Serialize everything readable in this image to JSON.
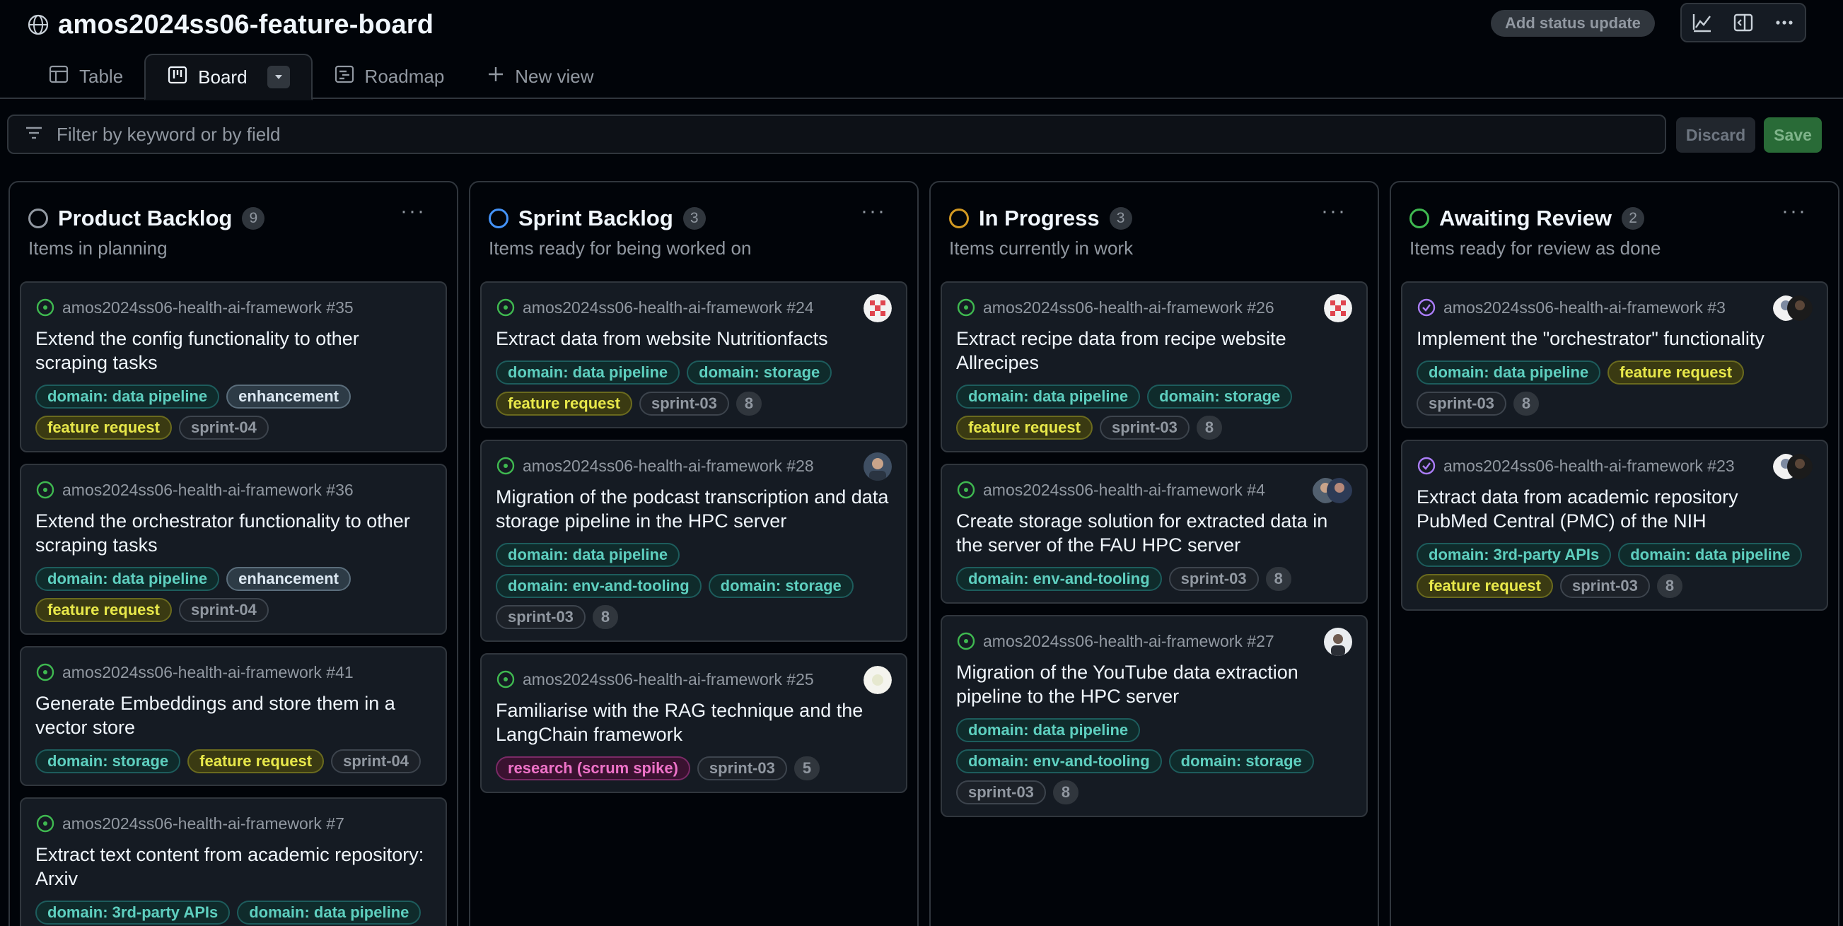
{
  "project": {
    "title": "amos2024ss06-feature-board",
    "status_update_label": "Add status update"
  },
  "tabs": [
    {
      "label": "Table",
      "icon": "table-icon"
    },
    {
      "label": "Board",
      "icon": "board-icon"
    },
    {
      "label": "Roadmap",
      "icon": "roadmap-icon"
    },
    {
      "label": "New view",
      "icon": "plus-icon"
    }
  ],
  "filter": {
    "placeholder": "Filter by keyword or by field",
    "discard_label": "Discard",
    "save_label": "Save"
  },
  "colors": {
    "product_backlog": "#9198a1",
    "sprint_backlog": "#4493f8",
    "in_progress": "#d29922",
    "awaiting_review": "#3fb950",
    "open_issue": "#3fb950",
    "closed_issue": "#ab7df8",
    "label_teal": "#2ea0a0",
    "label_yellow": "#d6d62e",
    "label_gray": "#8b949e",
    "label_pink": "#e85aad"
  },
  "columns": [
    {
      "title": "Product Backlog",
      "count": "9",
      "description": "Items in planning",
      "menu": "···",
      "cards": [
        {
          "meta": "amos2024ss06-health-ai-framework #35",
          "title": "Extend the config functionality to other scraping tasks",
          "status": "open",
          "avatar": "",
          "labels": [
            {
              "text": "domain: data pipeline",
              "kind": "teal"
            },
            {
              "text": "enhancement",
              "kind": "blue"
            },
            {
              "text": "feature request",
              "kind": "yellow"
            },
            {
              "text": "sprint-04",
              "kind": "gray"
            }
          ]
        },
        {
          "meta": "amos2024ss06-health-ai-framework #36",
          "title": "Extend the orchestrator functionality to other scraping tasks",
          "status": "open",
          "avatar": "",
          "labels": [
            {
              "text": "domain: data pipeline",
              "kind": "teal"
            },
            {
              "text": "enhancement",
              "kind": "blue"
            },
            {
              "text": "feature request",
              "kind": "yellow"
            },
            {
              "text": "sprint-04",
              "kind": "gray"
            }
          ]
        },
        {
          "meta": "amos2024ss06-health-ai-framework #41",
          "title": "Generate Embeddings and store them in a vector store",
          "status": "open",
          "avatar": "",
          "labels": [
            {
              "text": "domain: storage",
              "kind": "teal"
            },
            {
              "text": "feature request",
              "kind": "yellow"
            },
            {
              "text": "sprint-04",
              "kind": "gray"
            }
          ]
        },
        {
          "meta": "amos2024ss06-health-ai-framework #7",
          "title": "Extract text content from academic repository: Arxiv",
          "status": "open",
          "avatar": "",
          "labels": [
            {
              "text": "domain: 3rd-party APIs",
              "kind": "teal"
            },
            {
              "text": "domain: data pipeline",
              "kind": "teal"
            }
          ]
        }
      ]
    },
    {
      "title": "Sprint Backlog",
      "count": "3",
      "description": "Items ready for being worked on",
      "menu": "···",
      "cards": [
        {
          "meta": "amos2024ss06-health-ai-framework #24",
          "title": "Extract data from website Nutritionfacts",
          "status": "open",
          "avatar": "red",
          "labels": [
            {
              "text": "domain: data pipeline",
              "kind": "teal"
            },
            {
              "text": "domain: storage",
              "kind": "teal"
            },
            {
              "text": "feature request",
              "kind": "yellow"
            },
            {
              "text": "sprint-03",
              "kind": "gray"
            },
            {
              "text": "8",
              "kind": "num"
            }
          ]
        },
        {
          "meta": "amos2024ss06-health-ai-framework #28",
          "title": "Migration of the podcast transcription and data storage pipeline in the HPC server",
          "status": "open",
          "avatar": "photo",
          "labels": [
            {
              "text": "domain: data pipeline",
              "kind": "teal"
            },
            {
              "text": "domain: env-and-tooling",
              "kind": "teal"
            },
            {
              "text": "domain: storage",
              "kind": "teal"
            },
            {
              "text": "sprint-03",
              "kind": "gray"
            },
            {
              "text": "8",
              "kind": "num"
            }
          ]
        },
        {
          "meta": "amos2024ss06-health-ai-framework #25",
          "title": "Familiarise with the RAG technique and the LangChain framework",
          "status": "open",
          "avatar": "light",
          "labels": [
            {
              "text": "research (scrum spike)",
              "kind": "pink"
            },
            {
              "text": "sprint-03",
              "kind": "gray"
            },
            {
              "text": "5",
              "kind": "num"
            }
          ]
        }
      ]
    },
    {
      "title": "In Progress",
      "count": "3",
      "description": "Items currently in work",
      "menu": "···",
      "cards": [
        {
          "meta": "amos2024ss06-health-ai-framework #26",
          "title": "Extract recipe data from recipe website Allrecipes",
          "status": "open",
          "avatar": "red",
          "labels": [
            {
              "text": "domain: data pipeline",
              "kind": "teal"
            },
            {
              "text": "domain: storage",
              "kind": "teal"
            },
            {
              "text": "feature request",
              "kind": "yellow"
            },
            {
              "text": "sprint-03",
              "kind": "gray"
            },
            {
              "text": "8",
              "kind": "num"
            }
          ]
        },
        {
          "meta": "amos2024ss06-health-ai-framework #4",
          "title": "Create storage solution for extracted data in the server of the FAU HPC server",
          "status": "open",
          "avatar": "dual",
          "labels": [
            {
              "text": "domain: env-and-tooling",
              "kind": "teal"
            },
            {
              "text": "sprint-03",
              "kind": "gray"
            },
            {
              "text": "8",
              "kind": "num"
            }
          ]
        },
        {
          "meta": "amos2024ss06-health-ai-framework #27",
          "title": "Migration of the YouTube data extraction pipeline to the HPC server",
          "status": "open",
          "avatar": "photo2",
          "labels": [
            {
              "text": "domain: data pipeline",
              "kind": "teal"
            },
            {
              "text": "domain: env-and-tooling",
              "kind": "teal"
            },
            {
              "text": "domain: storage",
              "kind": "teal"
            },
            {
              "text": "sprint-03",
              "kind": "gray"
            },
            {
              "text": "8",
              "kind": "num"
            }
          ]
        }
      ]
    },
    {
      "title": "Awaiting Review",
      "count": "2",
      "description": "Items ready for review as done",
      "menu": "···",
      "cards": [
        {
          "meta": "amos2024ss06-health-ai-framework #3",
          "title": "Implement the \"orchestrator\" functionality",
          "status": "closed",
          "avatar": "dual2",
          "labels": [
            {
              "text": "domain: data pipeline",
              "kind": "teal"
            },
            {
              "text": "feature request",
              "kind": "yellow"
            },
            {
              "text": "sprint-03",
              "kind": "gray"
            },
            {
              "text": "8",
              "kind": "num"
            }
          ]
        },
        {
          "meta": "amos2024ss06-health-ai-framework #23",
          "title": "Extract data from academic repository PubMed Central (PMC) of the NIH",
          "status": "closed",
          "avatar": "dual2",
          "labels": [
            {
              "text": "domain: 3rd-party APIs",
              "kind": "teal"
            },
            {
              "text": "domain: data pipeline",
              "kind": "teal"
            },
            {
              "text": "feature request",
              "kind": "yellow"
            },
            {
              "text": "sprint-03",
              "kind": "gray"
            },
            {
              "text": "8",
              "kind": "num"
            }
          ]
        }
      ]
    }
  ]
}
